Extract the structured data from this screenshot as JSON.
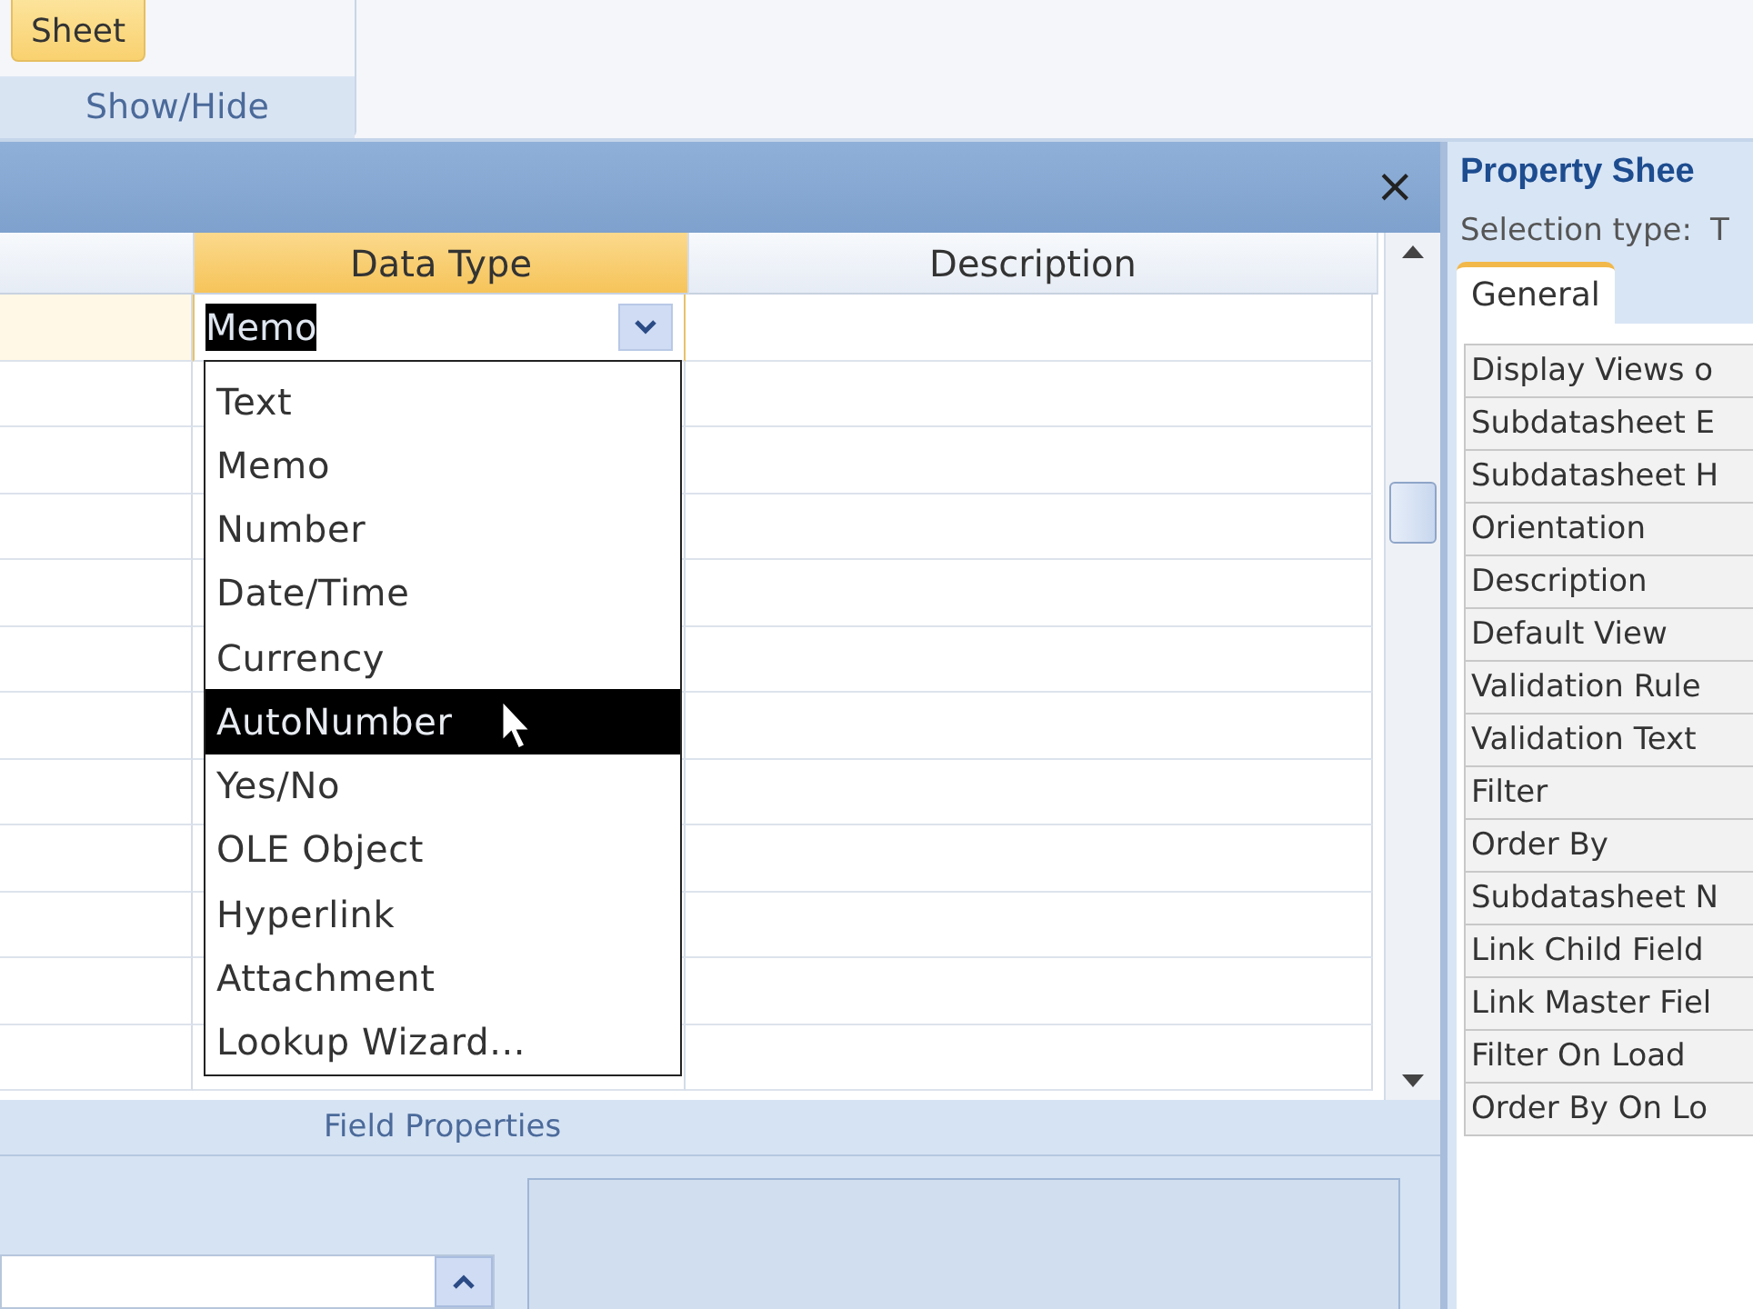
{
  "ribbon": {
    "button": "Sheet",
    "group": "Show/Hide"
  },
  "designer": {
    "close": "×",
    "columns": [
      {
        "label": "Data Type",
        "selected": true
      },
      {
        "label": "Description",
        "selected": false
      }
    ],
    "current_value": "Memo",
    "dropdown": [
      {
        "label": "Text",
        "selected": false
      },
      {
        "label": "Memo",
        "selected": false
      },
      {
        "label": "Number",
        "selected": false
      },
      {
        "label": "Date/Time",
        "selected": false
      },
      {
        "label": "Currency",
        "selected": false
      },
      {
        "label": "AutoNumber",
        "selected": true
      },
      {
        "label": "Yes/No",
        "selected": false
      },
      {
        "label": "OLE Object",
        "selected": false
      },
      {
        "label": "Hyperlink",
        "selected": false
      },
      {
        "label": "Attachment",
        "selected": false
      },
      {
        "label": "Lookup Wizard...",
        "selected": false
      }
    ],
    "section_label": "Field Properties"
  },
  "property_sheet": {
    "title": "Property Shee",
    "selection_label": "Selection type:",
    "selection_value": "T",
    "tabs": [
      {
        "label": "General",
        "selected": true
      }
    ],
    "properties": [
      "Display Views o",
      "Subdatasheet E",
      "Subdatasheet H",
      "Orientation",
      "Description",
      "Default View",
      "Validation Rule",
      "Validation Text",
      "Filter",
      "Order By",
      "Subdatasheet N",
      "Link Child Field",
      "Link Master Fiel",
      "Filter On Load",
      "Order By On Lo"
    ]
  }
}
